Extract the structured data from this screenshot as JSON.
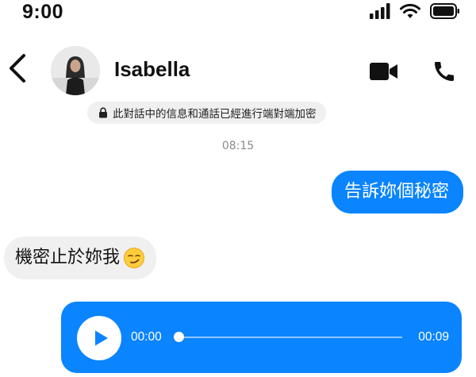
{
  "status_bar": {
    "time": "9:00",
    "icons": [
      "signal-bars-icon",
      "wifi-icon",
      "battery-icon"
    ]
  },
  "header": {
    "contact_name": "Isabella",
    "icons": [
      "back-arrow-icon",
      "video-camera-icon",
      "phone-icon"
    ]
  },
  "encryption_notice": "此對話中的信息和通話已經進行端對端加密",
  "timestamp": "08:15",
  "messages": [
    {
      "direction": "outgoing",
      "text": "告訴妳個秘密"
    },
    {
      "direction": "incoming",
      "text": "機密止於妳我",
      "emoji": "smirking-face-icon"
    }
  ],
  "voice_message": {
    "current_time": "00:00",
    "duration": "00:09",
    "progress": 0
  },
  "colors": {
    "bubble_blue": "#0a84ff",
    "bubble_gray": "#f0f0f0",
    "timestamp_gray": "#8a8a8a"
  }
}
